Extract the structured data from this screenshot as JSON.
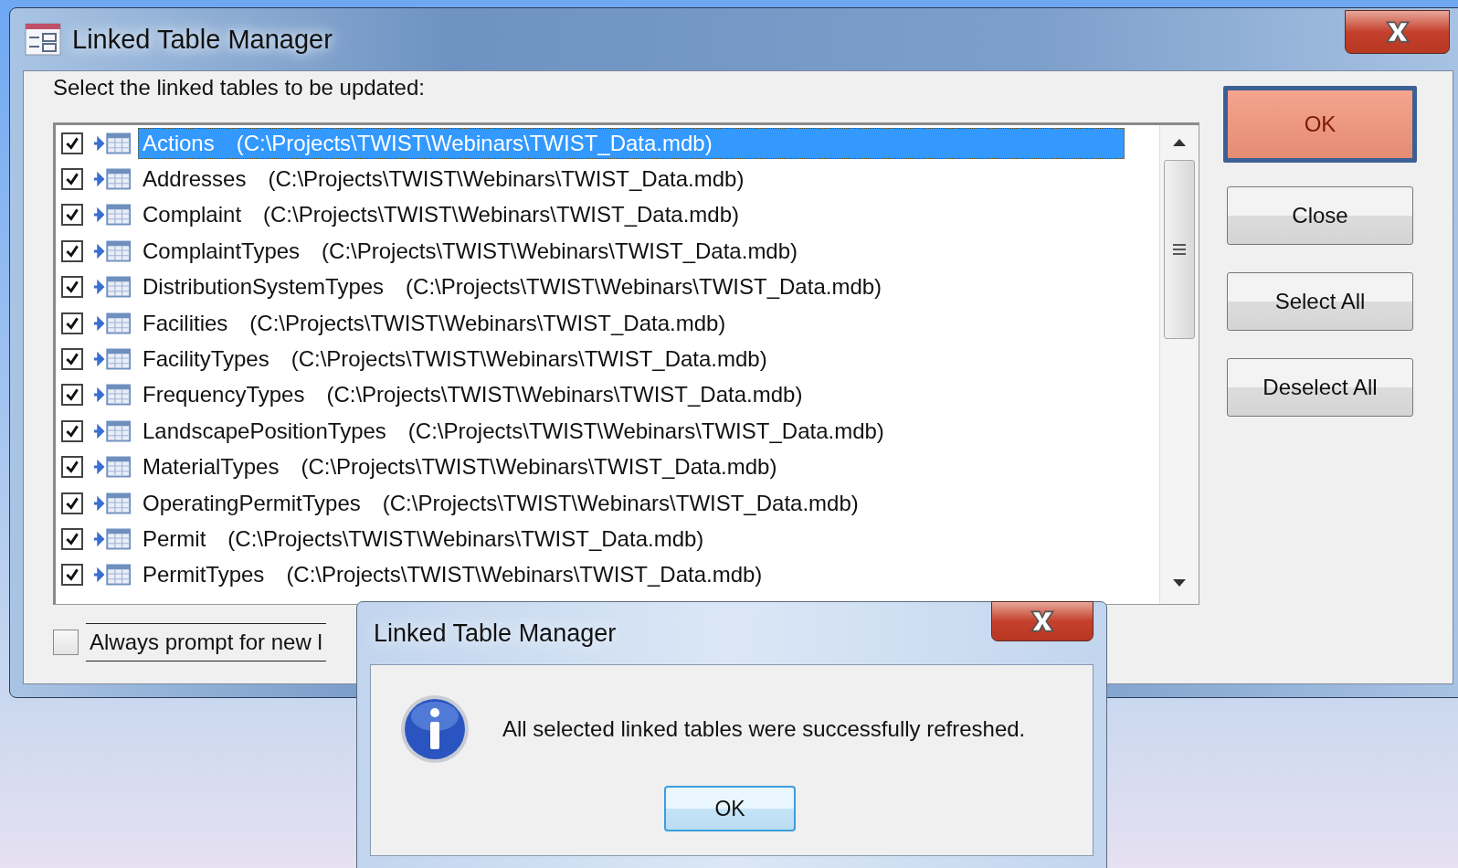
{
  "window": {
    "title": "Linked Table Manager"
  },
  "instruction": "Select the linked tables to be updated:",
  "tables": [
    {
      "name": "Actions",
      "path": "(C:\\Projects\\TWIST\\Webinars\\TWIST_Data.mdb)",
      "checked": true,
      "selected": true
    },
    {
      "name": "Addresses",
      "path": "(C:\\Projects\\TWIST\\Webinars\\TWIST_Data.mdb)",
      "checked": true,
      "selected": false
    },
    {
      "name": "Complaint",
      "path": "(C:\\Projects\\TWIST\\Webinars\\TWIST_Data.mdb)",
      "checked": true,
      "selected": false
    },
    {
      "name": "ComplaintTypes",
      "path": "(C:\\Projects\\TWIST\\Webinars\\TWIST_Data.mdb)",
      "checked": true,
      "selected": false
    },
    {
      "name": "DistributionSystemTypes",
      "path": "(C:\\Projects\\TWIST\\Webinars\\TWIST_Data.mdb)",
      "checked": true,
      "selected": false
    },
    {
      "name": "Facilities",
      "path": "(C:\\Projects\\TWIST\\Webinars\\TWIST_Data.mdb)",
      "checked": true,
      "selected": false
    },
    {
      "name": "FacilityTypes",
      "path": "(C:\\Projects\\TWIST\\Webinars\\TWIST_Data.mdb)",
      "checked": true,
      "selected": false
    },
    {
      "name": "FrequencyTypes",
      "path": "(C:\\Projects\\TWIST\\Webinars\\TWIST_Data.mdb)",
      "checked": true,
      "selected": false
    },
    {
      "name": "LandscapePositionTypes",
      "path": "(C:\\Projects\\TWIST\\Webinars\\TWIST_Data.mdb)",
      "checked": true,
      "selected": false
    },
    {
      "name": "MaterialTypes",
      "path": "(C:\\Projects\\TWIST\\Webinars\\TWIST_Data.mdb)",
      "checked": true,
      "selected": false
    },
    {
      "name": "OperatingPermitTypes",
      "path": "(C:\\Projects\\TWIST\\Webinars\\TWIST_Data.mdb)",
      "checked": true,
      "selected": false
    },
    {
      "name": "Permit",
      "path": "(C:\\Projects\\TWIST\\Webinars\\TWIST_Data.mdb)",
      "checked": true,
      "selected": false
    },
    {
      "name": "PermitTypes",
      "path": "(C:\\Projects\\TWIST\\Webinars\\TWIST_Data.mdb)",
      "checked": true,
      "selected": false
    }
  ],
  "buttons": [
    {
      "label": "OK",
      "default": true
    },
    {
      "label": "Close",
      "default": false
    },
    {
      "label": "Select All",
      "default": false
    },
    {
      "label": "Deselect All",
      "default": false
    }
  ],
  "always_prompt": {
    "label": "Always prompt for new l",
    "checked": false
  },
  "message_box": {
    "title": "Linked Table Manager",
    "message": "All selected linked tables were successfully refreshed.",
    "button": "OK"
  }
}
